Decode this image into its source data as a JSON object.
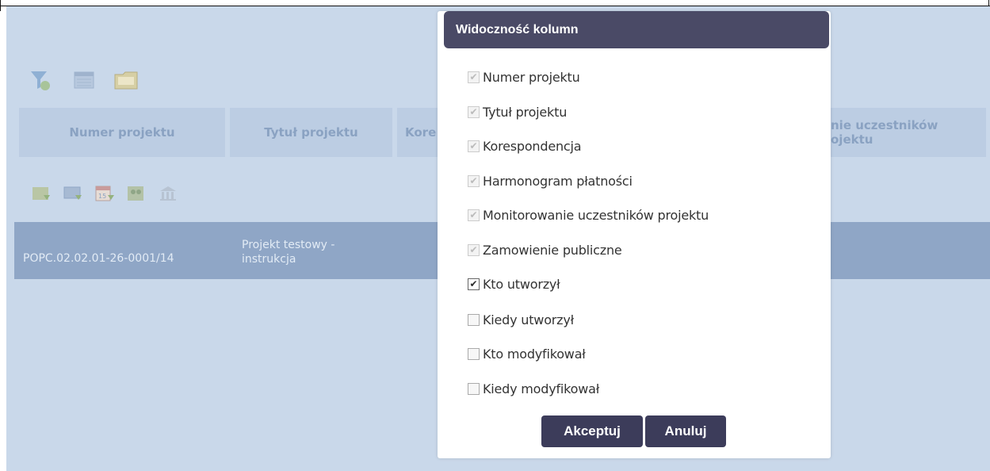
{
  "toolbar": {
    "icons": [
      "filter-icon",
      "list-icon",
      "folder-icon"
    ]
  },
  "columns": {
    "numer": "Numer projektu",
    "tytul": "Tytuł projektu",
    "kore": "Kore",
    "monit_line1": "nie uczestników",
    "monit_line2": "ojektu"
  },
  "row_icons": [
    "correspondence-icon",
    "monitor-icon",
    "calendar-icon",
    "participants-icon",
    "bank-icon"
  ],
  "row": {
    "numer": "POPC.02.02.01-26-0001/14",
    "tytul": "Projekt testowy - instrukcja"
  },
  "dialog": {
    "title": "Widoczność kolumn",
    "options": [
      {
        "label": "Numer projektu",
        "checked": true,
        "disabled": true
      },
      {
        "label": "Tytuł projektu",
        "checked": true,
        "disabled": true
      },
      {
        "label": "Korespondencja",
        "checked": true,
        "disabled": true
      },
      {
        "label": "Harmonogram płatności",
        "checked": true,
        "disabled": true
      },
      {
        "label": "Monitorowanie uczestników projektu",
        "checked": true,
        "disabled": true
      },
      {
        "label": "Zamowienie publiczne",
        "checked": true,
        "disabled": true
      },
      {
        "label": "Kto utworzył",
        "checked": true,
        "disabled": false
      },
      {
        "label": "Kiedy utworzył",
        "checked": false,
        "disabled": false
      },
      {
        "label": "Kto modyfikował",
        "checked": false,
        "disabled": false
      },
      {
        "label": "Kiedy modyfikował",
        "checked": false,
        "disabled": false
      }
    ],
    "accept_label": "Akceptuj",
    "cancel_label": "Anuluj"
  },
  "colors": {
    "background": "#c9d8ea",
    "header_bar": "#4a4a66",
    "button": "#3c3c5a",
    "row": "#8fa6c6"
  }
}
